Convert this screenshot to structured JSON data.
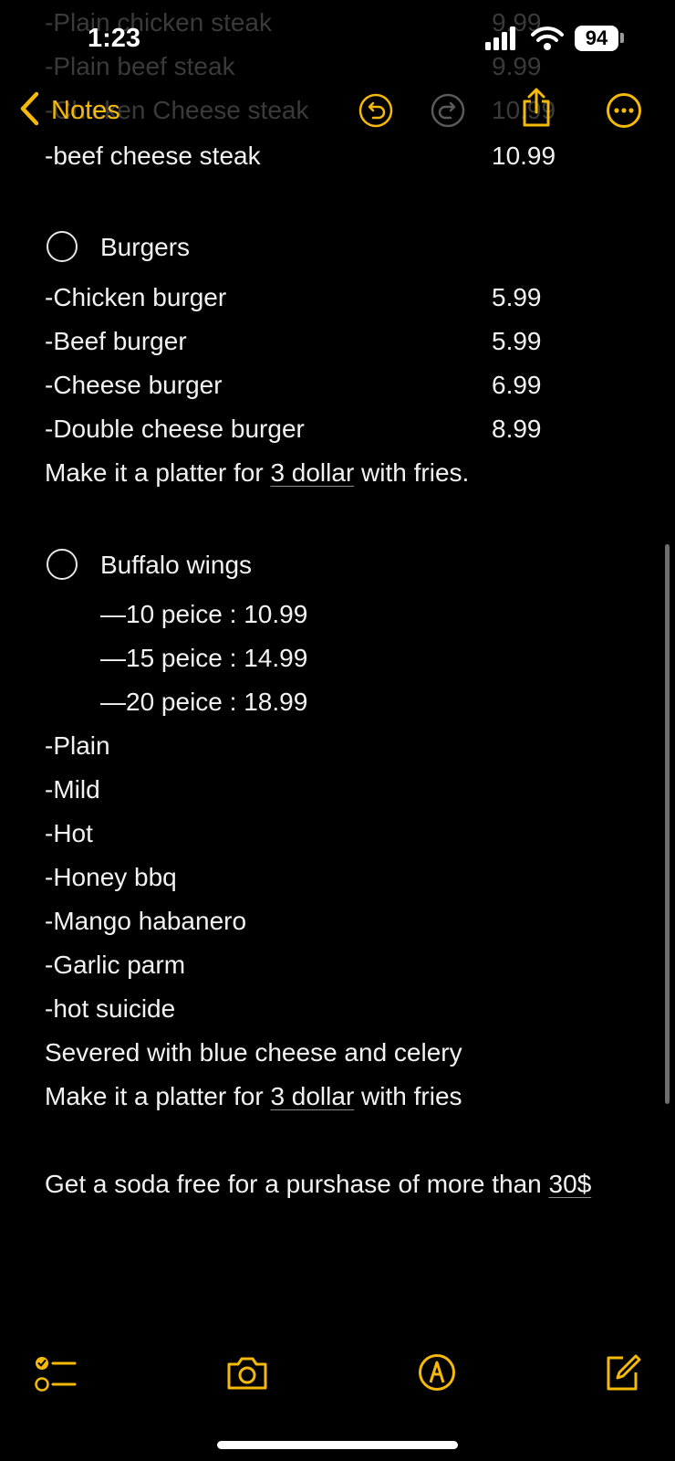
{
  "status": {
    "time": "1:23",
    "battery": "94"
  },
  "nav": {
    "back_label": "Notes",
    "colors": {
      "accent": "#f5b90a",
      "disabled": "#5a5a5a"
    }
  },
  "behind_nav": [
    {
      "name": "-Plain chicken steak",
      "price": "9.99"
    },
    {
      "name": "-Plain beef steak",
      "price": "9.99"
    },
    {
      "name": "-Chicken Cheese steak",
      "price": "10.99"
    }
  ],
  "steak_last": {
    "name": "-beef cheese steak",
    "price": "10.99"
  },
  "burgers": {
    "heading": "Burgers",
    "items": [
      {
        "name": "-Chicken burger",
        "price": "5.99"
      },
      {
        "name": "-Beef burger",
        "price": "5.99"
      },
      {
        "name": "-Cheese burger",
        "price": "6.99"
      },
      {
        "name": "-Double cheese burger",
        "price": "8.99"
      }
    ],
    "platter": {
      "pre": "Make it a platter for ",
      "link": "3 dollar",
      "post": " with fries."
    }
  },
  "wings": {
    "heading": "Buffalo wings",
    "sizes": [
      "—10 peice : 10.99",
      "—15 peice : 14.99",
      "—20 peice : 18.99"
    ],
    "flavors": [
      "-Plain",
      "-Mild",
      "-Hot",
      "-Honey bbq",
      "-Mango habanero",
      "-Garlic parm",
      "-hot suicide"
    ],
    "served": "Severed with blue cheese and celery",
    "platter": {
      "pre": "Make it a platter for ",
      "link": "3 dollar",
      "post": " with fries"
    }
  },
  "promo": {
    "pre": "Get a soda free for a purshase of more than ",
    "link": "30$"
  },
  "toolbar": {
    "icons": [
      "checklist-icon",
      "camera-icon",
      "markup-icon",
      "compose-icon"
    ]
  }
}
